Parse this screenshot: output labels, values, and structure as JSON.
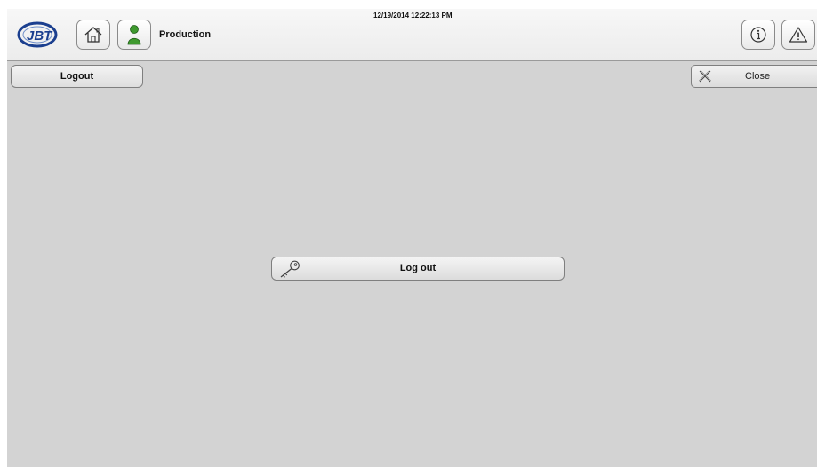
{
  "header": {
    "brand": "JBT",
    "user_label": "Production",
    "datetime": "12/19/2014 12:22:13 PM",
    "icons": [
      "home-icon",
      "user-icon",
      "info-icon",
      "warning-icon"
    ]
  },
  "toolbar": {
    "tab_label": "Logout",
    "close_label": "Close"
  },
  "main": {
    "logout_label": "Log out"
  },
  "colors": {
    "background": "#d3d3d3",
    "header": "#f1f1f1",
    "user_icon": "#3f9a2f",
    "logo": "#1b3f8f"
  }
}
